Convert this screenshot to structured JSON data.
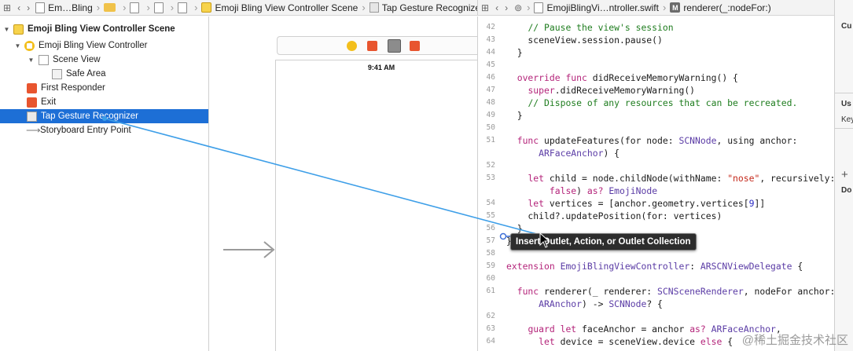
{
  "left_jumpbar": {
    "items": [
      {
        "label": "Em…Bling",
        "icon": "file-icon"
      },
      {
        "label": "",
        "icon": "folder-icon"
      },
      {
        "label": "",
        "icon": "file-icon"
      },
      {
        "label": "",
        "icon": "file-icon"
      },
      {
        "label": "",
        "icon": "file-icon"
      },
      {
        "label": "Emoji Bling View Controller Scene",
        "icon": "storyboard-scene-icon"
      },
      {
        "label": "Tap Gesture Recognizer",
        "icon": "gesture-recognizer-icon"
      }
    ]
  },
  "right_jumpbar": {
    "file": "EmojiBlingVi…ntroller.swift",
    "method": "renderer(_:nodeFor:)"
  },
  "outline": {
    "items": [
      {
        "label": "Emoji Bling View Controller Scene",
        "icon": "scene-icon"
      },
      {
        "label": "Emoji Bling View Controller",
        "icon": "view-controller-icon"
      },
      {
        "label": "Scene View",
        "icon": "view-icon"
      },
      {
        "label": "Safe Area",
        "icon": "safe-area-icon"
      },
      {
        "label": "First Responder",
        "icon": "first-responder-icon"
      },
      {
        "label": "Exit",
        "icon": "exit-icon"
      },
      {
        "label": "Tap Gesture Recognizer",
        "icon": "gesture-recognizer-icon"
      },
      {
        "label": "Storyboard Entry Point",
        "icon": "arrow-right-icon"
      }
    ],
    "selected": "Tap Gesture Recognizer"
  },
  "canvas": {
    "status_time": "9:41 AM"
  },
  "code": {
    "line_numbers": [
      "42",
      "43",
      "44",
      "45",
      "46",
      "47",
      "48",
      "49",
      "50",
      "51",
      "",
      "52",
      "53",
      "",
      "54",
      "55",
      "56",
      "57",
      "58",
      "59",
      "60",
      "61",
      "",
      "62",
      "63",
      "64"
    ]
  },
  "tooltip": "Insert Outlet, Action, or Outlet Collection",
  "inspector": {
    "labels": [
      "Cu",
      "Us",
      "Key",
      "Do"
    ]
  },
  "watermark": "@稀土掘金技术社区",
  "colors": {
    "selection": "#1d6fd6",
    "connection_line": "#3e9fe8",
    "keyword": "#b4247a",
    "type": "#5a3ba5",
    "comment": "#1f7d1f",
    "string": "#c4281a"
  }
}
